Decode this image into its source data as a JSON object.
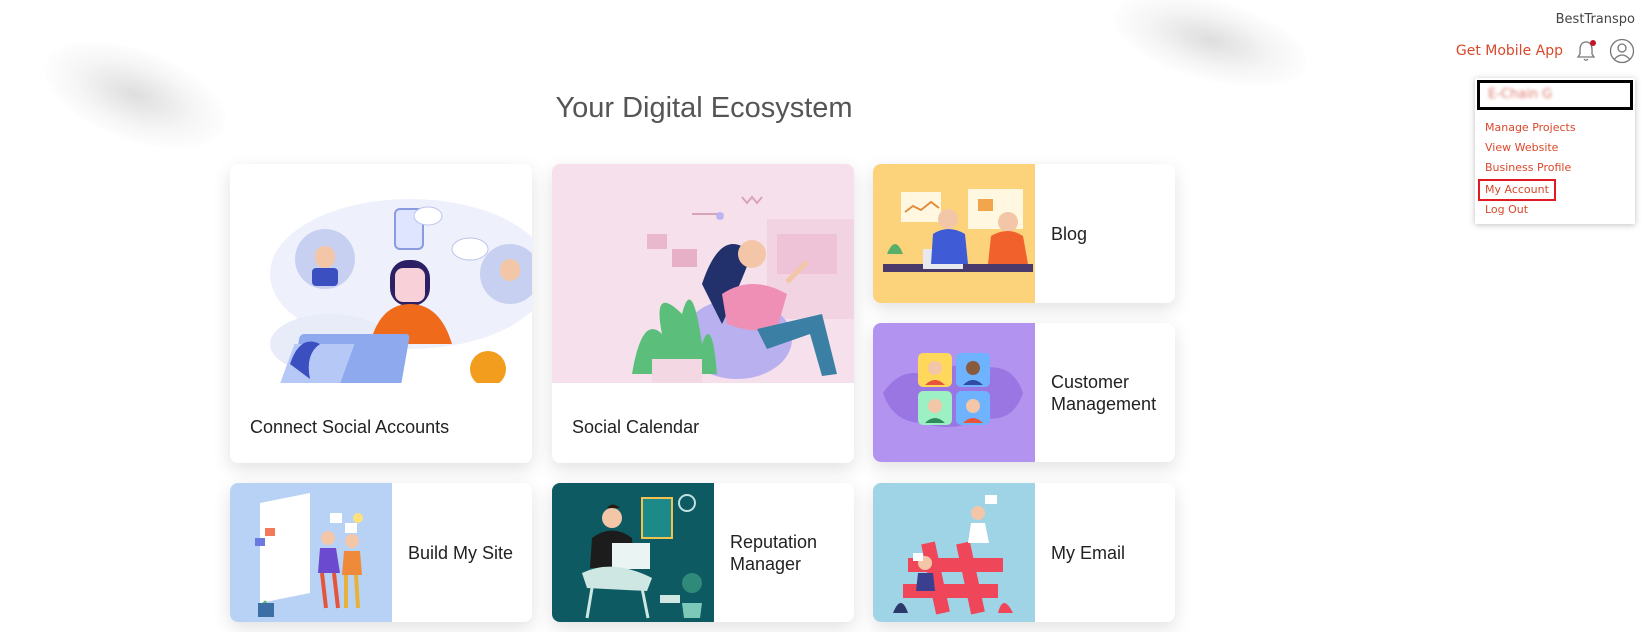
{
  "header": {
    "brand": "BestTranspo",
    "get_app_label": "Get Mobile App"
  },
  "account_menu": {
    "user_name": "E-Chain G",
    "items": [
      {
        "label": "Manage Projects"
      },
      {
        "label": "View Website"
      },
      {
        "label": "Business Profile"
      },
      {
        "label": "My Account",
        "highlighted": true
      },
      {
        "label": "Log Out"
      }
    ]
  },
  "main": {
    "title": "Your Digital Ecosystem",
    "cards": [
      {
        "label": "Connect Social Accounts"
      },
      {
        "label": "Social Calendar"
      },
      {
        "label": "Blog"
      },
      {
        "label": "Customer Management"
      },
      {
        "label": "Build My Site"
      },
      {
        "label": "Reputation Manager"
      },
      {
        "label": "My Email"
      }
    ]
  },
  "colors": {
    "accent": "#d9482b",
    "highlight_border": "#e01b24"
  },
  "icons": [
    "bell-icon",
    "user-circle-icon"
  ]
}
